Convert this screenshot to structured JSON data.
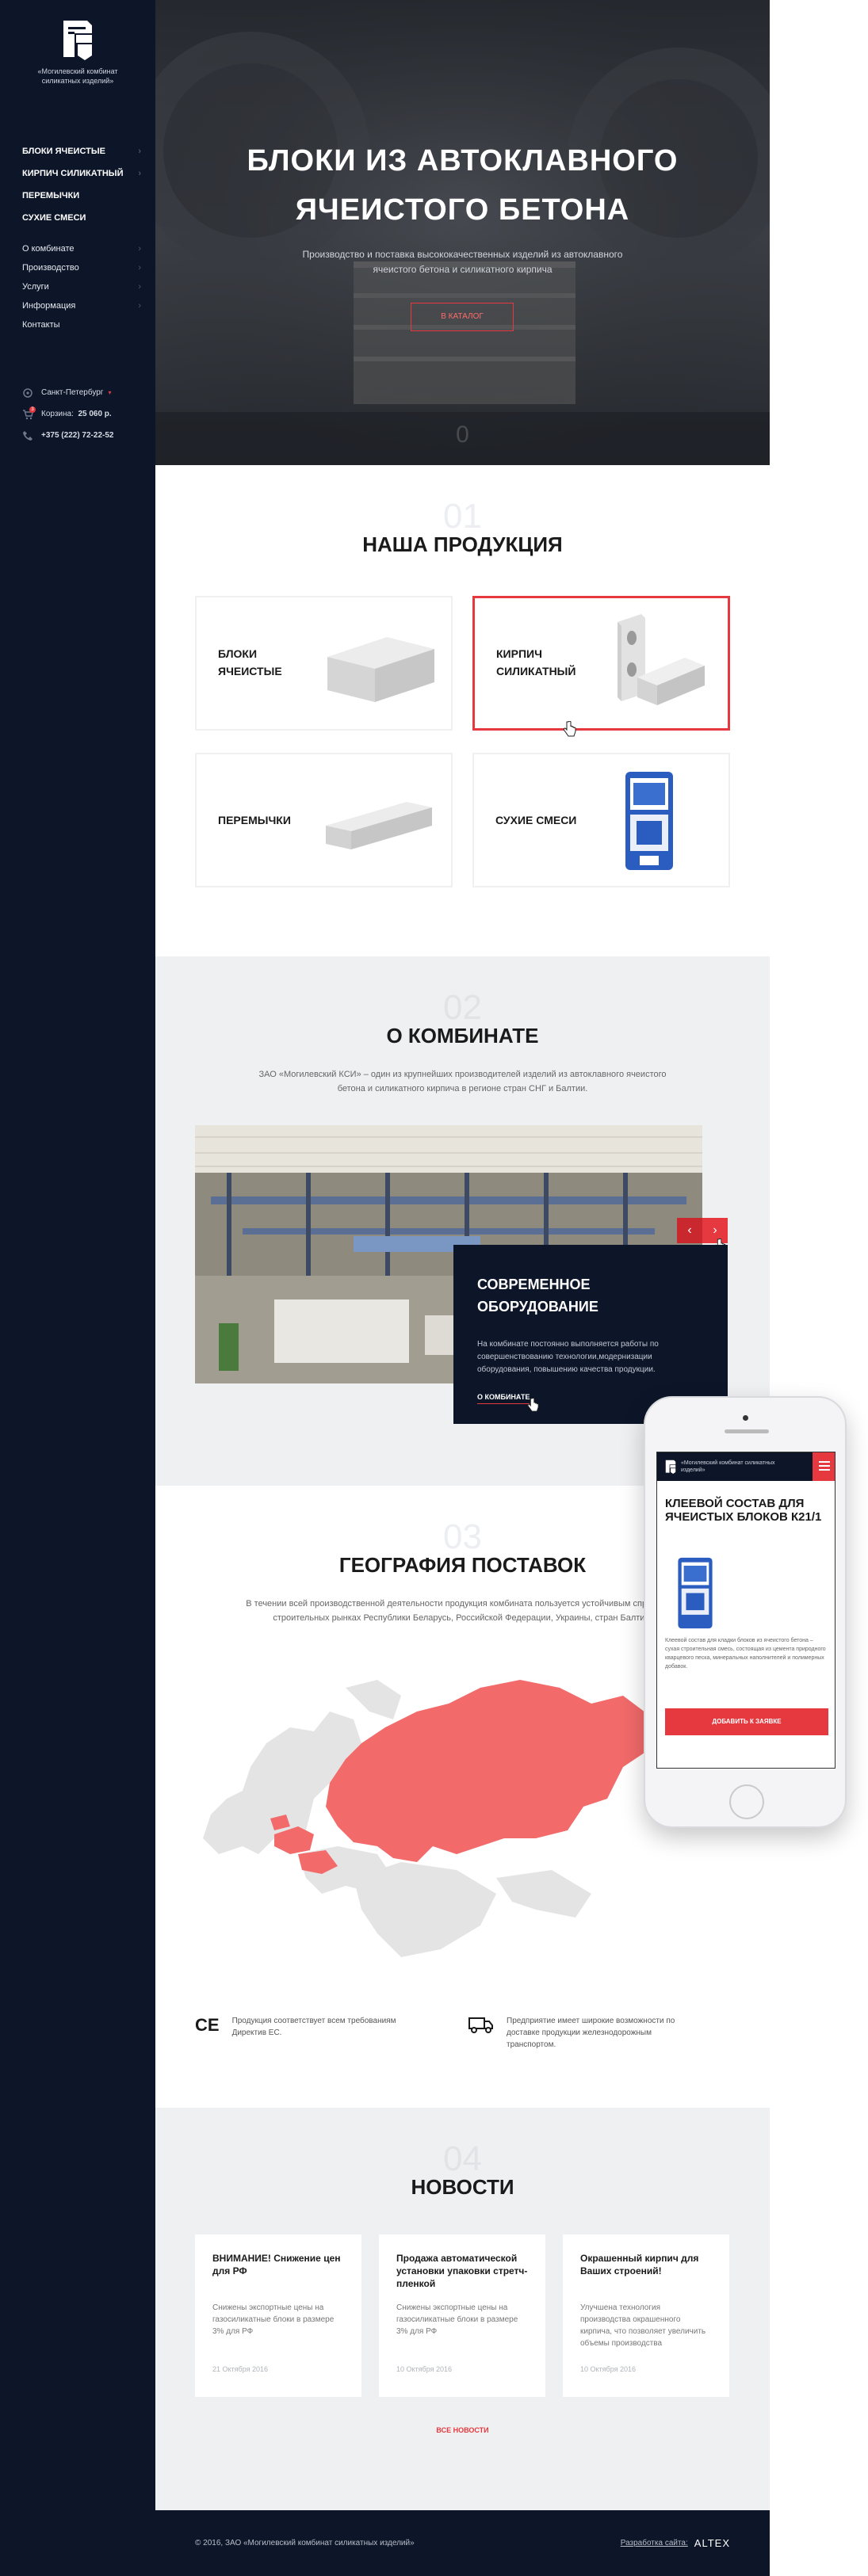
{
  "brand": {
    "logo_text": "«Могилевский комбинат силикатных изделий»"
  },
  "nav_main": [
    {
      "label": "БЛОКИ ЯЧЕИСТЫЕ",
      "chevron": true
    },
    {
      "label": "КИРПИЧ СИЛИКАТНЫЙ",
      "chevron": true
    },
    {
      "label": "ПЕРЕМЫЧКИ",
      "chevron": false
    },
    {
      "label": "СУХИЕ СМЕСИ",
      "chevron": false
    }
  ],
  "nav_sub": [
    {
      "label": "О комбинате",
      "chevron": true
    },
    {
      "label": "Производство",
      "chevron": true
    },
    {
      "label": "Услуги",
      "chevron": true
    },
    {
      "label": "Информация",
      "chevron": true
    },
    {
      "label": "Контакты",
      "chevron": false
    }
  ],
  "contacts": {
    "city": "Санкт-Петербург",
    "cart_label": "Корзина:",
    "cart_total": "25 060 р.",
    "cart_count": "3",
    "phone": "+375 (222) 72-22-52"
  },
  "hero": {
    "title_line1": "БЛОКИ ИЗ АВТОКЛАВНОГО",
    "title_line2": "ЯЧЕИСТОГО БЕТОНА",
    "subtitle": "Производство и поставка высококачественных изделий из автоклавного ячеистого бетона и силикатного кирпича",
    "button": "В КАТАЛОГ",
    "slide_num": "0"
  },
  "products": {
    "num": "01",
    "title": "НАША ПРОДУКЦИЯ",
    "items": [
      {
        "line1": "БЛОКИ",
        "line2": "ЯЧЕИСТЫЕ"
      },
      {
        "line1": "КИРПИЧ",
        "line2": "СИЛИКАТНЫЙ"
      },
      {
        "line1": "ПЕРЕМЫЧКИ",
        "line2": ""
      },
      {
        "line1": "СУХИЕ СМЕСИ",
        "line2": ""
      }
    ]
  },
  "about": {
    "num": "02",
    "title": "О КОМБИНАТЕ",
    "desc": "ЗАО «Могилевский КСИ» – один из крупнейших производителей изделий из автоклавного ячеистого бетона и силикатного кирпича в регионе стран СНГ и Балтии.",
    "slide_title_line1": "СОВРЕМЕННОЕ",
    "slide_title_line2": "ОБОРУДОВАНИЕ",
    "slide_desc": "На комбинате постоянно выполняется работы по совершенствованию технологии,модернизации оборудования, повышению качества продукции.",
    "slide_link": "О КОМБИНАТЕ",
    "prev": "‹",
    "next": "›"
  },
  "geo": {
    "num": "03",
    "title": "ГЕОГРАФИЯ ПОСТАВОК",
    "desc": "В течении всей производственной деятельности продукция комбината пользуется устойчивым спросом на строительных рынках Республики Беларусь, Российской Федерации, Украины, стран Балтии.",
    "feature1_icon": "CE",
    "feature1": "Продукция соответствует всем требованиям Директив ЕС.",
    "feature2": "Предприятие имеет широкие возможности по доставке продукции железнодорожным транспортом."
  },
  "news": {
    "num": "04",
    "title": "НОВОСТИ",
    "items": [
      {
        "title": "ВНИМАНИЕ! Снижение цен для РФ",
        "desc": "Снижены экспортные цены на газосиликатные блоки в размере 3% для РФ",
        "date": "21 Октября 2016"
      },
      {
        "title": "Продажа автоматической установки упаковки стретч-пленкой",
        "desc": "Снижены экспортные цены на газосиликатные блоки в размере 3% для РФ",
        "date": "10 Октября 2016"
      },
      {
        "title": "Окрашенный кирпич для Ваших строений!",
        "desc": "Улучшена технология производства окрашенного кирпича, что позволяет увеличить объемы производства",
        "date": "10 Октября 2016"
      }
    ],
    "all_link": "ВСЕ НОВОСТИ"
  },
  "footer": {
    "copyright": "© 2016, ЗАО «Могилевский комбинат силикатных изделий»",
    "dev_label": "Разработка сайта:",
    "dev_brand": "ALTEX"
  },
  "mobile": {
    "logo_text": "«Могилевский комбинат силикатных изделий»",
    "title": "КЛЕЕВОЙ СОСТАВ ДЛЯ ЯЧЕИСТЫХ БЛОКОВ К21/1",
    "desc": "Клеевой состав для кладки блоков из ячеистого бетона – сухая строительная смесь, состоящая из цемента природного кварцевого песка, минеральных наполнителей и полимерных добавок.",
    "button": "ДОБАВИТЬ К ЗАЯВКЕ"
  },
  "colors": {
    "accent": "#e5393f",
    "navy": "#0d1629",
    "light_bg": "#eff0f2"
  }
}
